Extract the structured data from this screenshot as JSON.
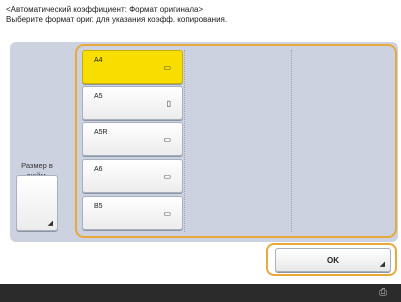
{
  "header": {
    "line1": "<Автоматический коэффициент: Формат оригинала>",
    "line2": "Выберите формат ориг. для указания коэфф. копирования."
  },
  "sizes": [
    {
      "label": "A4",
      "orientation_icon": "landscape-page-icon",
      "glyph": "▭",
      "selected": true
    },
    {
      "label": "A5",
      "orientation_icon": "portrait-page-icon",
      "glyph": "▯",
      "selected": false
    },
    {
      "label": "A5R",
      "orientation_icon": "landscape-page-icon",
      "glyph": "▭",
      "selected": false
    },
    {
      "label": "A6",
      "orientation_icon": "landscape-page-icon",
      "glyph": "▭",
      "selected": false
    },
    {
      "label": "B5",
      "orientation_icon": "landscape-page-icon",
      "glyph": "▭",
      "selected": false
    }
  ],
  "inch_button": {
    "label": "Размер в дюйм."
  },
  "ok_button": {
    "label": "OK"
  },
  "colors": {
    "selected": "#f8de00",
    "focus_frame": "#e9a93a",
    "panel": "#ccd2e0",
    "footer": "#2b2b2b"
  },
  "footer": {
    "icon": "device-status-icon"
  }
}
